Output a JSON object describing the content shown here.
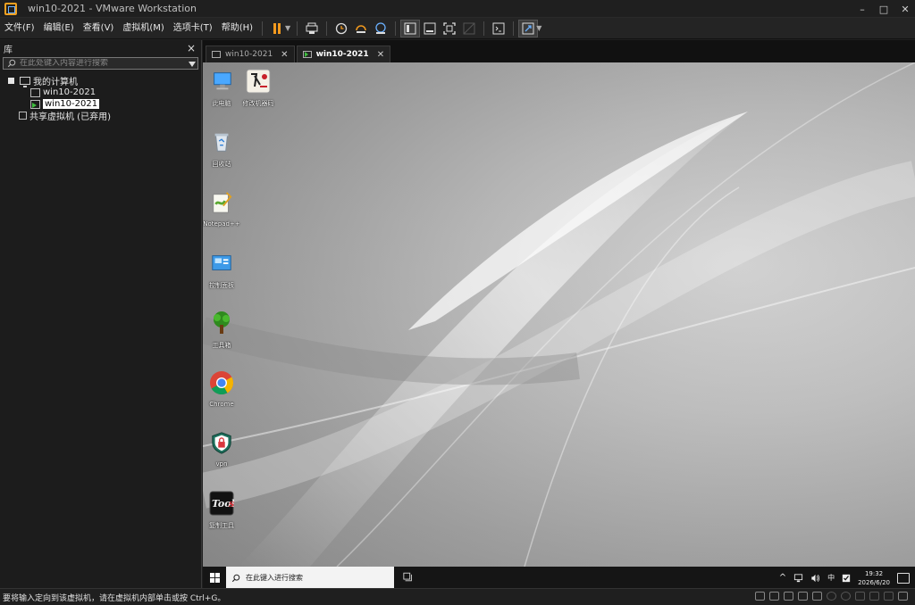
{
  "window": {
    "title": "win10-2021 - VMware Workstation",
    "controls": {
      "minimize": "–",
      "maximize": "□",
      "close": "✕"
    }
  },
  "menu": {
    "items": [
      "文件(F)",
      "编辑(E)",
      "查看(V)",
      "虚拟机(M)",
      "选项卡(T)",
      "帮助(H)"
    ]
  },
  "toolbar": {
    "icons": [
      "pause-icon",
      "send-ctrl-alt-del-icon",
      "snapshot-icon",
      "revert-snapshot-icon",
      "snapshot-manager-icon",
      "show-library-icon",
      "thumbnail-bar-icon",
      "fullscreen-icon",
      "unity-icon",
      "console-view-icon",
      "stretch-guest-icon"
    ],
    "accent": "#f39a1e"
  },
  "library": {
    "title": "库",
    "close": "×",
    "search_placeholder": "在此处键入内容进行搜索",
    "tree": {
      "root": "我的计算机",
      "vms": [
        "win10-2021",
        "win10-2021"
      ],
      "shared": "共享虚拟机 (已弃用)"
    }
  },
  "tabs": [
    {
      "label": "win10-2021",
      "close": "✕"
    },
    {
      "label": "win10-2021",
      "close": "✕"
    }
  ],
  "desktop": {
    "icons": [
      {
        "label": "此电脑",
        "icon": "this-pc-icon"
      },
      {
        "label": "修改机器码",
        "icon": "fengyun-tool-icon"
      },
      {
        "label": "回收站",
        "icon": "recycle-bin-icon"
      },
      {
        "label": "Notepad++",
        "icon": "notepad-plus-plus-icon"
      },
      {
        "label": "控制面板",
        "icon": "control-panel-icon"
      },
      {
        "label": "工具箱",
        "icon": "tree-icon"
      },
      {
        "label": "Chrome",
        "icon": "chrome-icon"
      },
      {
        "label": "vpn",
        "icon": "vpn-shield-icon"
      },
      {
        "label": "复制工具",
        "icon": "tools-icon"
      }
    ]
  },
  "taskbar": {
    "search_placeholder": "在此键入进行搜索",
    "ime": "中",
    "time": "19:32",
    "date": "2026/6/20"
  },
  "statusbar": {
    "message": "要将输入定向到该虚拟机，请在虚拟机内部单击或按 Ctrl+G。"
  }
}
